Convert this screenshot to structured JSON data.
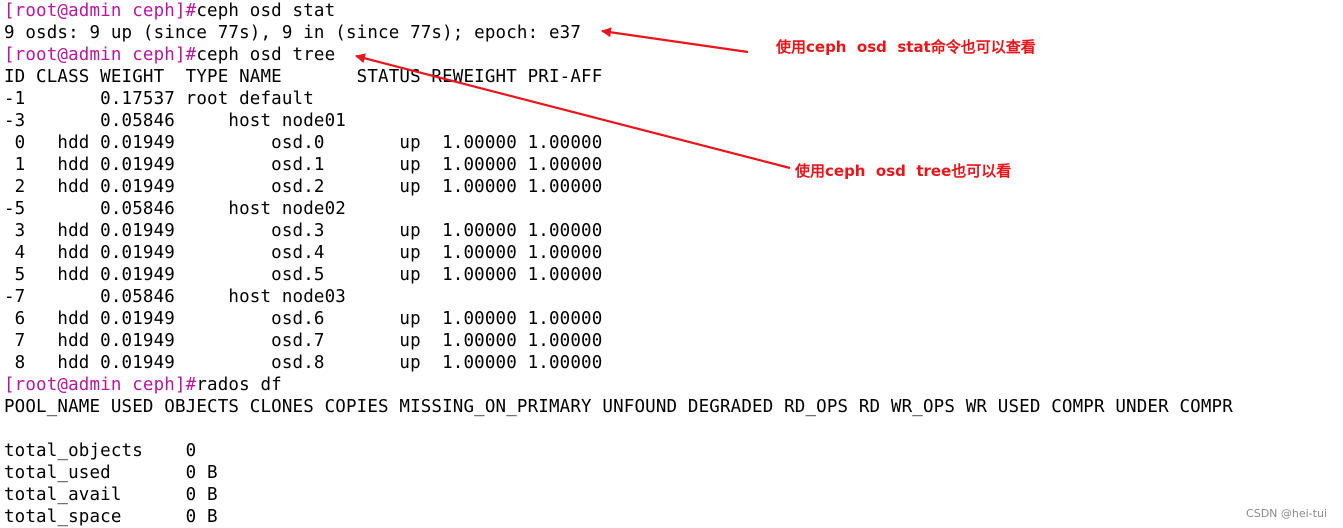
{
  "terminal": {
    "prompt": "[root@admin ceph]#",
    "lines": [
      {
        "kind": "cmd",
        "text": "ceph osd stat"
      },
      {
        "kind": "out",
        "text": "9 osds: 9 up (since 77s), 9 in (since 77s); epoch: e37"
      },
      {
        "kind": "cmd",
        "text": "ceph osd tree"
      },
      {
        "kind": "out",
        "text": "ID CLASS WEIGHT  TYPE NAME       STATUS REWEIGHT PRI-AFF"
      },
      {
        "kind": "out",
        "text": "-1       0.17537 root default"
      },
      {
        "kind": "out",
        "text": "-3       0.05846     host node01"
      },
      {
        "kind": "out",
        "text": " 0   hdd 0.01949         osd.0       up  1.00000 1.00000"
      },
      {
        "kind": "out",
        "text": " 1   hdd 0.01949         osd.1       up  1.00000 1.00000"
      },
      {
        "kind": "out",
        "text": " 2   hdd 0.01949         osd.2       up  1.00000 1.00000"
      },
      {
        "kind": "out",
        "text": "-5       0.05846     host node02"
      },
      {
        "kind": "out",
        "text": " 3   hdd 0.01949         osd.3       up  1.00000 1.00000"
      },
      {
        "kind": "out",
        "text": " 4   hdd 0.01949         osd.4       up  1.00000 1.00000"
      },
      {
        "kind": "out",
        "text": " 5   hdd 0.01949         osd.5       up  1.00000 1.00000"
      },
      {
        "kind": "out",
        "text": "-7       0.05846     host node03"
      },
      {
        "kind": "out",
        "text": " 6   hdd 0.01949         osd.6       up  1.00000 1.00000"
      },
      {
        "kind": "out",
        "text": " 7   hdd 0.01949         osd.7       up  1.00000 1.00000"
      },
      {
        "kind": "out",
        "text": " 8   hdd 0.01949         osd.8       up  1.00000 1.00000"
      },
      {
        "kind": "cmd",
        "text": "rados df"
      },
      {
        "kind": "out",
        "text": "POOL_NAME USED OBJECTS CLONES COPIES MISSING_ON_PRIMARY UNFOUND DEGRADED RD_OPS RD WR_OPS WR USED COMPR UNDER COMPR"
      },
      {
        "kind": "out",
        "text": ""
      },
      {
        "kind": "out",
        "text": "total_objects    0"
      },
      {
        "kind": "out",
        "text": "total_used       0 B"
      },
      {
        "kind": "out",
        "text": "total_avail      0 B"
      },
      {
        "kind": "out",
        "text": "total_space      0 B"
      }
    ]
  },
  "annotations": {
    "stat_note": "使用ceph  osd  stat命令也可以查看",
    "tree_note": "使用ceph  osd  tree也可以看",
    "color": "#e8151b"
  },
  "watermark": "CSDN @hei-tui",
  "colors": {
    "prompt": "#b5179e",
    "text": "#000000",
    "background": "#ffffff"
  }
}
